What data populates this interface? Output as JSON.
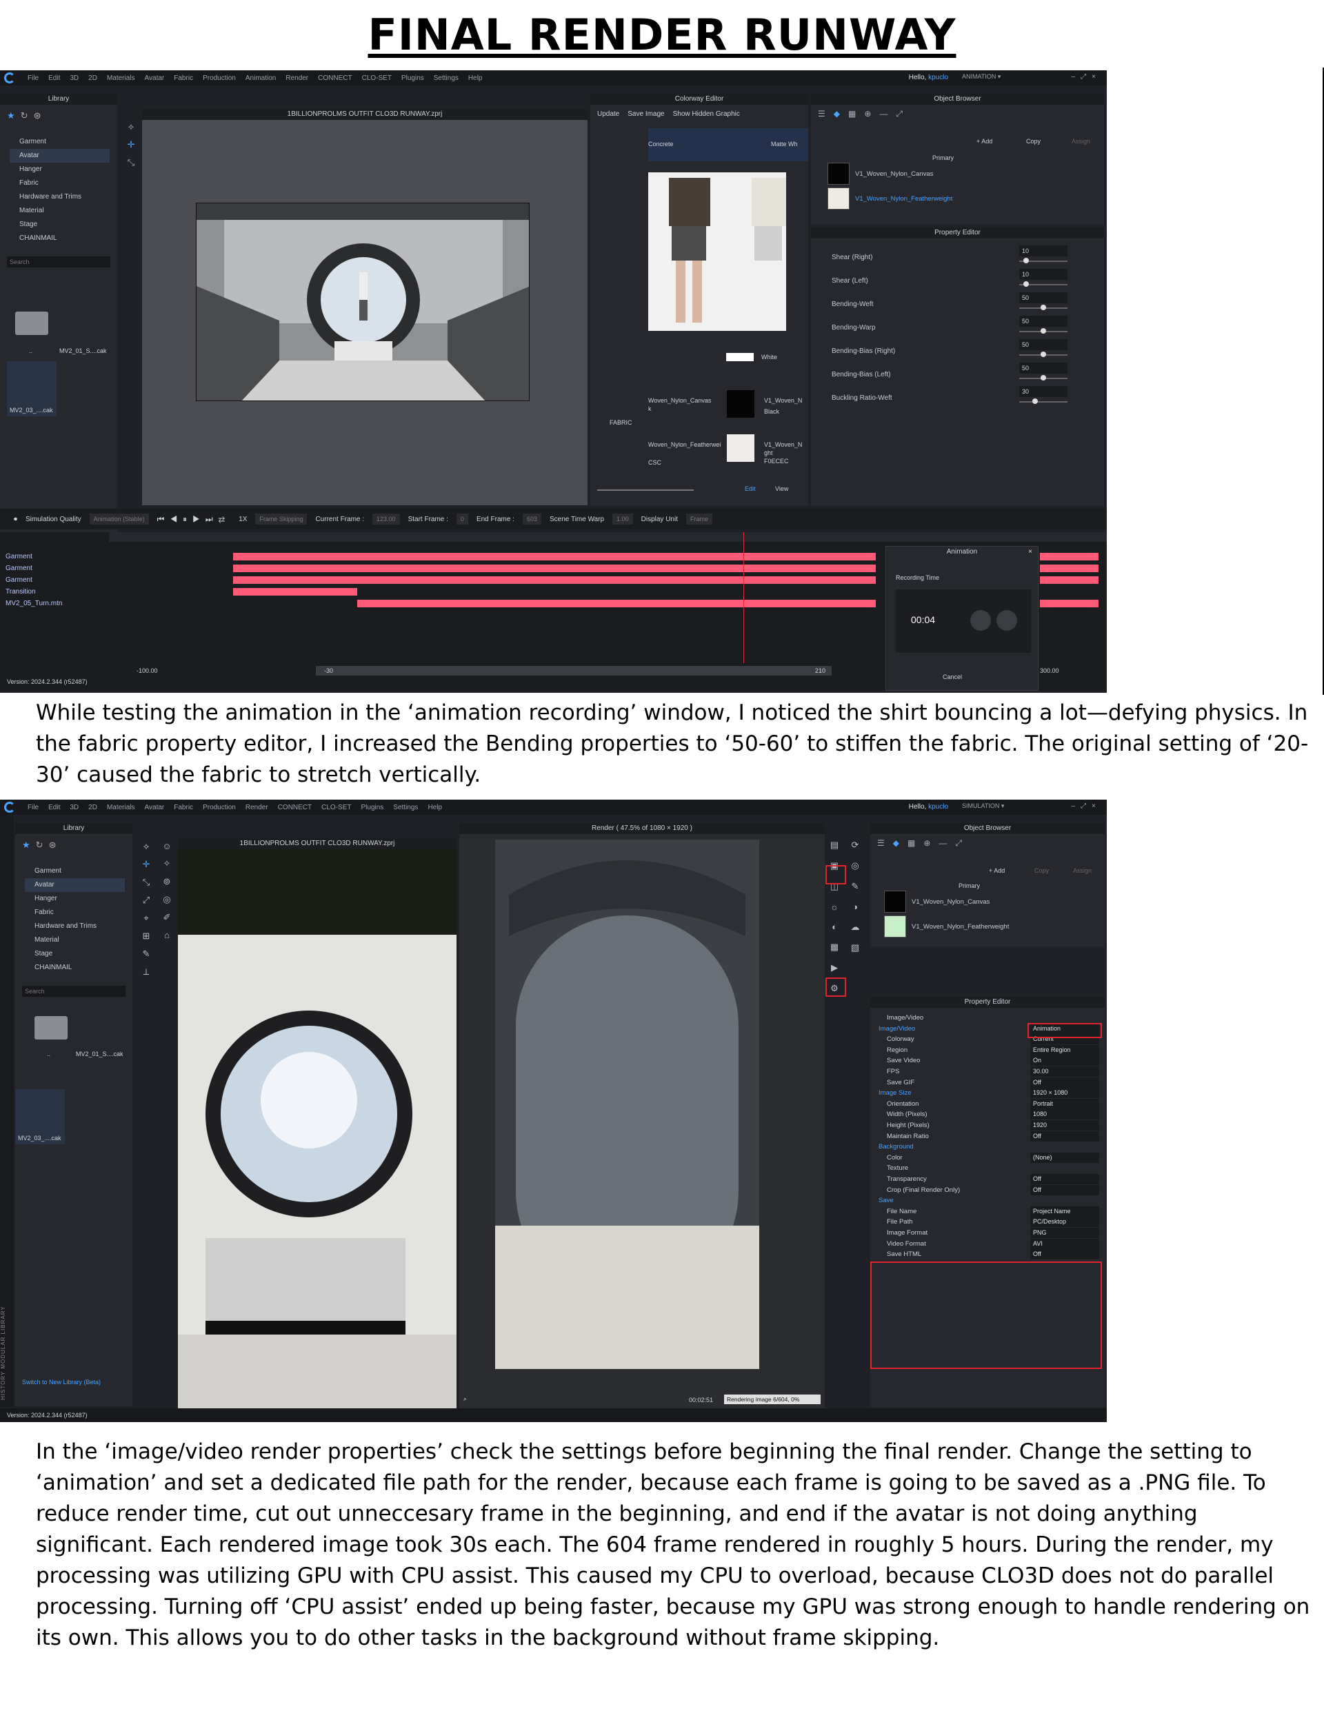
{
  "page": {
    "title": "FINAL RENDER RUNWAY",
    "caption1": "While testing the animation in the ‘animation recording’ window, I noticed the shirt bouncing a lot—defying physics. In the fabric property editor, I increased the Bending properties to ‘50-60’ to stiffen the fabric. The original setting of ‘20-30’ caused the fabric to stretch vertically.",
    "caption2": "In the ‘image/video render properties’ check the settings before beginning the final render. Change the setting to ‘animation’ and set a dedicated file path for the render, because each frame is going to be saved as a .PNG file. To reduce render time, cut out unneccesary frame in the beginning, and end if the avatar is not doing anything significant. Each rendered image took 30s each. The 604 frame rendered in roughly 5 hours. During the render, my processing was utilizing GPU with CPU assist. This caused my CPU to overload, because CLO3D does not do parallel processing. Turning off ‘CPU assist’ ended up being faster, because my GPU was strong enough to handle rendering on its own. This allows you to do other tasks in the background without frame skipping."
  },
  "menu": [
    "File",
    "Edit",
    "3D",
    "2D",
    "Materials",
    "Avatar",
    "Fabric",
    "Production",
    "Animation",
    "Render",
    "CONNECT",
    "CLO-SET",
    "Plugins",
    "Settings",
    "Help"
  ],
  "menu2": [
    "File",
    "Edit",
    "3D",
    "2D",
    "Materials",
    "Avatar",
    "Fabric",
    "Production",
    "Render",
    "CONNECT",
    "CLO-SET",
    "Plugins",
    "Settings",
    "Help"
  ],
  "app": {
    "hello": "Hello,",
    "user": "kpuclo",
    "mode1": "ANIMATION",
    "mode2": "SIMULATION",
    "project": "1BILLIONPROLMS OUTFIT CLO3D RUNWAY.zprj",
    "version": "Version: 2024.2.344 (r52487)"
  },
  "library": {
    "title": "Library",
    "items": [
      "Garment",
      "Avatar",
      "Hanger",
      "Fabric",
      "Hardware and Trims",
      "Material",
      "Stage",
      "CHAINMAIL"
    ],
    "search": "Search",
    "file1": "MV2_01_S....cak",
    "file2": "MV2_03_....cak",
    "dotdot": "..",
    "switch": "Switch to New Library (Beta)"
  },
  "colorway": {
    "title": "Colorway Editor",
    "update": "Update",
    "save_image": "Save Image",
    "hidden": "Show Hidden Graphic",
    "col1": "Concrete",
    "col2": "Matte Wh",
    "white": "White",
    "fabric": "FABRIC",
    "fab1": "Woven_Nylon_Canvas",
    "fab1b": "k",
    "fab2": "Woven_Nylon_Featherwei",
    "fab2b": "CSC",
    "sw1name": "V1_Woven_N",
    "sw1col": "Black",
    "sw2name": "V1_Woven_N",
    "sw2b": "ght",
    "sw2col": "F0ECEC",
    "edit": "Edit",
    "view": "View"
  },
  "object_browser": {
    "title": "Object Browser",
    "add": "+ Add",
    "copy": "Copy",
    "assign": "Assign",
    "primary": "Primary",
    "fabric1": "V1_Woven_Nylon_Canvas",
    "fabric2": "V1_Woven_Nylon_Featherweight"
  },
  "property_editor": {
    "title": "Property Editor",
    "rows": [
      {
        "label": "Shear (Right)",
        "value": "10"
      },
      {
        "label": "Shear (Left)",
        "value": "10"
      },
      {
        "label": "Bending-Weft",
        "value": "50"
      },
      {
        "label": "Bending-Warp",
        "value": "50"
      },
      {
        "label": "Bending-Bias (Right)",
        "value": "50"
      },
      {
        "label": "Bending-Bias (Left)",
        "value": "50"
      },
      {
        "label": "Buckling Ratio-Weft",
        "value": "30"
      }
    ]
  },
  "anim_bar": {
    "sim_quality": "Simulation Quality",
    "sim_value": "Animation (Stable)",
    "speed": "1X",
    "frame_skip": "Frame Skipping",
    "current_frame": "Current Frame :",
    "current_val": "123.00",
    "start_frame": "Start Frame :",
    "start_val": "0",
    "end_frame": "End Frame :",
    "end_val": "603",
    "warp": "Scene Time Warp",
    "warp_val": "1.00",
    "display_unit": "Display Unit",
    "display_val": "Frame"
  },
  "tracks": {
    "labels": [
      "Garment",
      "Garment",
      "Garment",
      "Transition",
      "MV2_05_Turn.mtn"
    ],
    "range_left": "-100.00",
    "range_mid_left": "-30",
    "range_mid_right": "210",
    "range_right": "300.00"
  },
  "recording": {
    "title": "Animation",
    "label": "Recording Time",
    "time": "00:04",
    "cancel": "Cancel"
  },
  "render": {
    "title": "Render ( 47.5% of 1080 × 1920 )",
    "time": "00:02:51",
    "progress": "Rendering image 6/604, 0%"
  },
  "side_strip": "HISTORY  MODULAR LIBRARY",
  "render_props": {
    "title": "Property Editor",
    "rows": [
      {
        "k": "Image/Video",
        "v": "",
        "sec": false
      },
      {
        "k": "Image/Video",
        "v": "Animation",
        "sec": true
      },
      {
        "k": "Colorway",
        "v": "Current",
        "sec": false
      },
      {
        "k": "Region",
        "v": "Entire Region",
        "sec": false
      },
      {
        "k": "Save Video",
        "v": "On",
        "sec": false
      },
      {
        "k": "FPS",
        "v": "30.00",
        "sec": false
      },
      {
        "k": "Save GIF",
        "v": "Off",
        "sec": false
      },
      {
        "k": "Image Size",
        "v": "1920 × 1080",
        "sec": true
      },
      {
        "k": "Orientation",
        "v": "Portrait",
        "sec": false
      },
      {
        "k": "Width (Pixels)",
        "v": "1080",
        "sec": false
      },
      {
        "k": "Height (Pixels)",
        "v": "1920",
        "sec": false
      },
      {
        "k": "Maintain Ratio",
        "v": "Off",
        "sec": false
      },
      {
        "k": "Background",
        "v": "",
        "sec": true
      },
      {
        "k": "Color",
        "v": "(None)",
        "sec": false
      },
      {
        "k": "Texture",
        "v": "",
        "sec": false
      },
      {
        "k": "Transparency",
        "v": "Off",
        "sec": false
      },
      {
        "k": "Crop (Final Render Only)",
        "v": "Off",
        "sec": false
      },
      {
        "k": "Save",
        "v": "",
        "sec": true
      },
      {
        "k": "File Name",
        "v": "Project Name",
        "sec": false
      },
      {
        "k": "File Path",
        "v": "PC/Desktop",
        "sec": false
      },
      {
        "k": "Image Format",
        "v": "PNG",
        "sec": false
      },
      {
        "k": "Video Format",
        "v": "AVI",
        "sec": false
      },
      {
        "k": "Save HTML",
        "v": "Off",
        "sec": false
      }
    ]
  },
  "colors": {
    "accent": "#4aa3ff",
    "track": "#ff5a78",
    "highlight": "#e0242b"
  }
}
